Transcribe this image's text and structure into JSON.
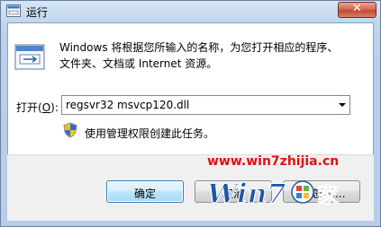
{
  "window": {
    "title": "运行",
    "close_icon": "close-icon"
  },
  "dialog": {
    "description": "Windows 将根据您所输入的名称，为您打开相应的程序、文件夹、文档或 Internet 资源。",
    "open_label_prefix": "打开(",
    "open_label_hotkey": "O",
    "open_label_suffix": "):",
    "command_value": "regsvr32 msvcp120.dll",
    "admin_note": "使用管理权限创建此任务。"
  },
  "buttons": {
    "ok": "确定",
    "cancel": "取消",
    "browse": "浏览(B)..."
  },
  "watermark": {
    "url": "www.win7zhijia.cn",
    "logo_text": "Win7之家"
  },
  "colors": {
    "watermark_red": "#e01010",
    "close_red": "#c24a32",
    "ok_border": "#3c7fb1"
  }
}
